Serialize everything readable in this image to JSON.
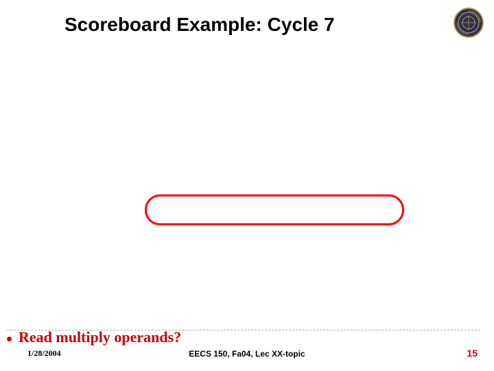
{
  "title": "Scoreboard Example: Cycle 7",
  "bullet": {
    "text": "Read multiply operands?"
  },
  "footer": {
    "date": "1/28/2004",
    "center": "EECS 150, Fa04, Lec XX-topic",
    "page": "15"
  },
  "colors": {
    "accent": "#cc0000",
    "highlight": "#FF0000"
  },
  "icons": {
    "seal": "institution-seal-icon"
  }
}
